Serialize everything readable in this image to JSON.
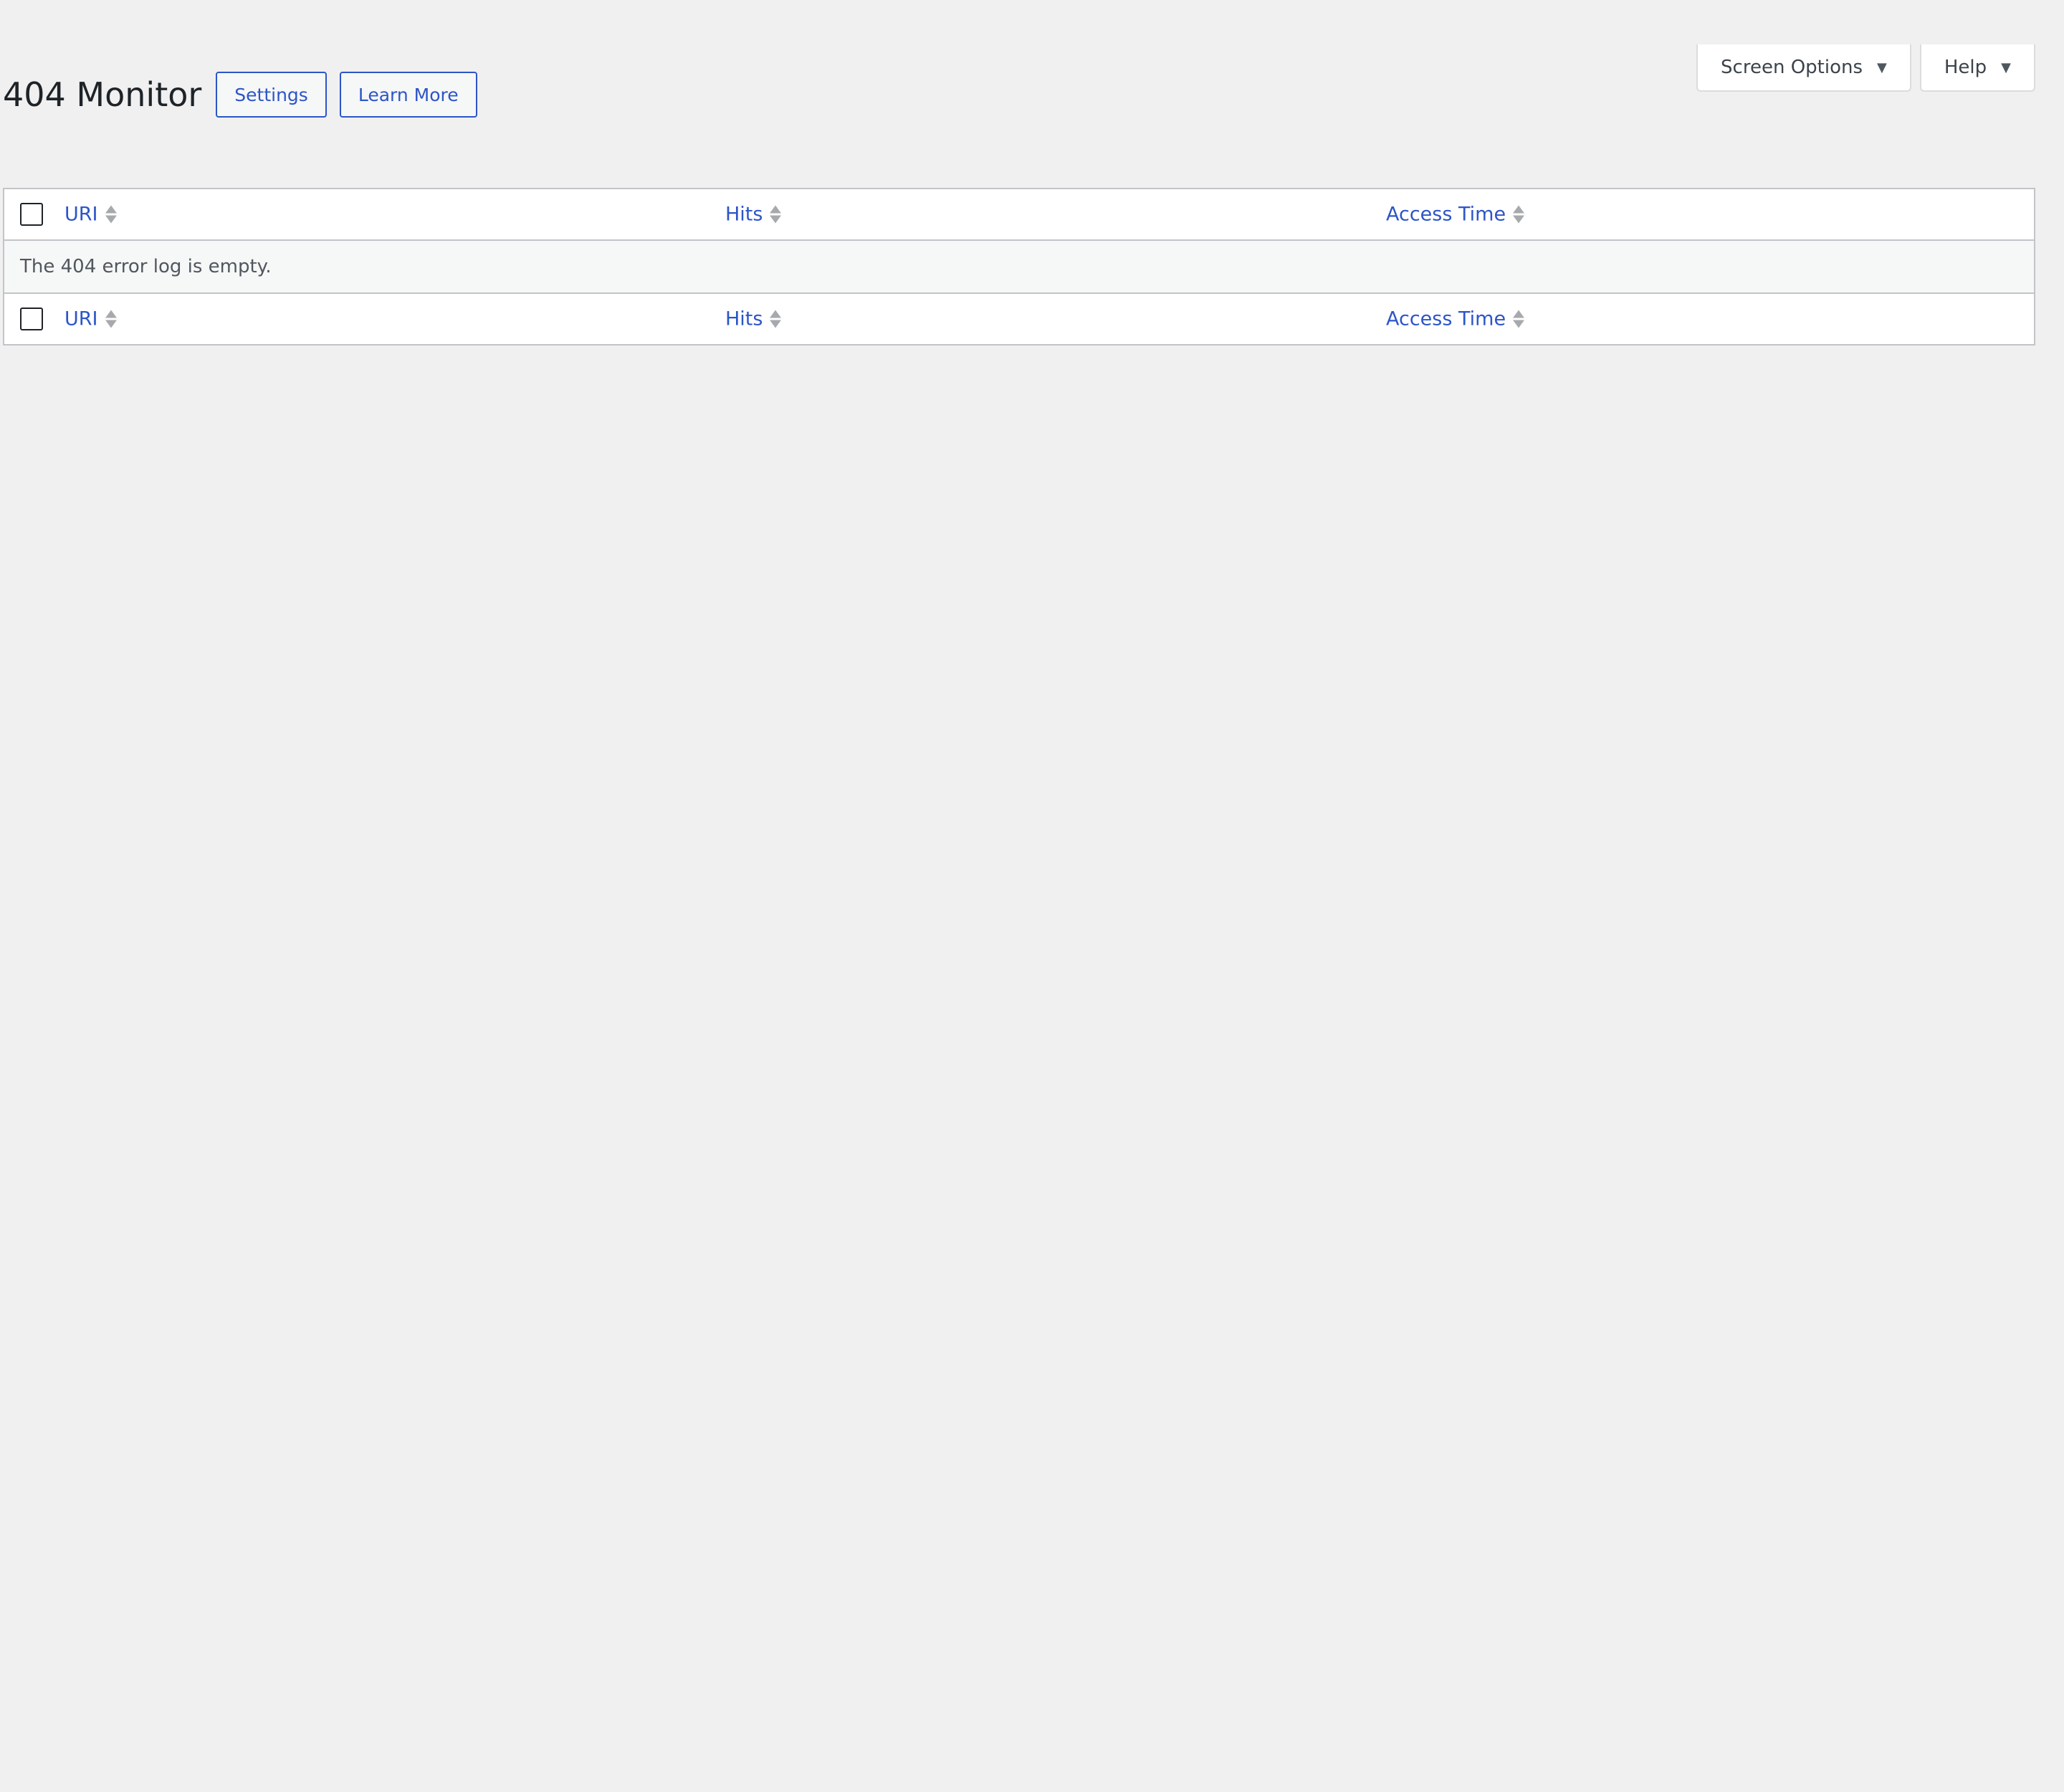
{
  "header": {
    "title": "404 Monitor",
    "actions": {
      "settings_label": "Settings",
      "learn_more_label": "Learn More"
    }
  },
  "screen_meta": {
    "screen_options_label": "Screen Options",
    "help_label": "Help"
  },
  "table": {
    "columns": {
      "uri": "URI",
      "hits": "Hits",
      "access_time": "Access Time"
    },
    "empty_message": "The 404 error log is empty."
  },
  "colors": {
    "link": "#2c55c8",
    "background": "#f0f0f1",
    "border": "#c3c4c7",
    "sort_icon": "#a7aaad"
  }
}
